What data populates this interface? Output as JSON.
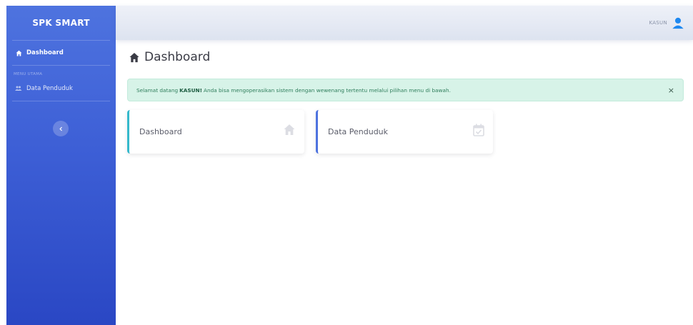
{
  "sidebar": {
    "brand": "SPK SMART",
    "items": [
      {
        "label": "Dashboard",
        "icon": "home-icon",
        "active": true
      },
      {
        "label": "Data Penduduk",
        "icon": "users-icon",
        "active": false
      }
    ],
    "section_heading": "MENU UTAMA",
    "toggle_icon": "chevron-left-icon"
  },
  "topbar": {
    "user_name": "KASUN",
    "avatar_icon": "user-icon"
  },
  "main": {
    "page_title": "Dashboard",
    "alert": {
      "prefix": "Selamat datang",
      "user": "KASUN!",
      "suffix": "Anda bisa mengoperasikan sistem dengan wewenang tertentu melalui pilihan menu di bawah.",
      "close": "×"
    },
    "cards": [
      {
        "label": "Dashboard",
        "icon": "home-icon",
        "accent": "#36b9cc"
      },
      {
        "label": "Data Penduduk",
        "icon": "calendar-check-icon",
        "accent": "#4e73df"
      }
    ]
  },
  "colors": {
    "sidebar_top": "#4e73df",
    "sidebar_bottom": "#2a47c4",
    "alert_bg": "#d7f3e8",
    "alert_text": "#2e7d5b"
  }
}
